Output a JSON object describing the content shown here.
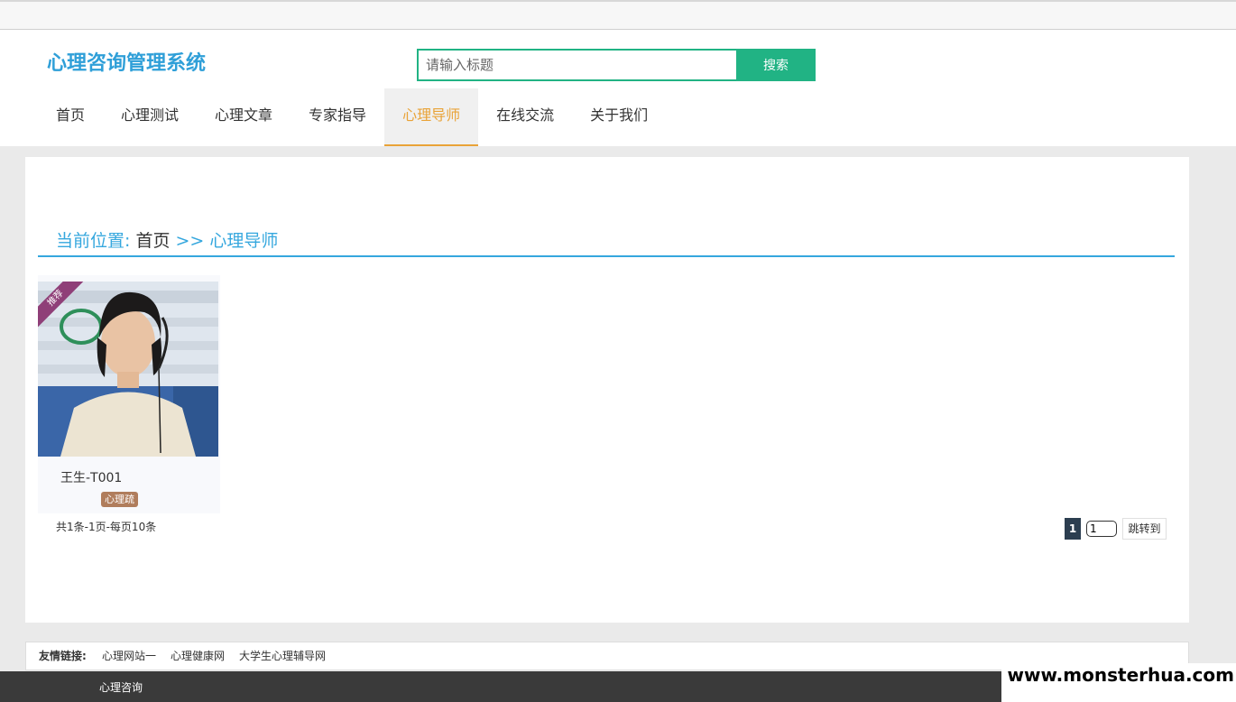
{
  "header": {
    "logo": "心理咨询管理系统",
    "search_placeholder": "请输入标题",
    "search_button": "搜索"
  },
  "nav": {
    "items": [
      "首页",
      "心理测试",
      "心理文章",
      "专家指导",
      "心理导师",
      "在线交流",
      "关于我们"
    ],
    "active": "心理导师"
  },
  "breadcrumb": {
    "label": "当前位置:",
    "home": "首页",
    "separator": ">>",
    "current": "心理导师"
  },
  "teachers": [
    {
      "ribbon": "推荐",
      "name": "王生-T001",
      "badge": "心理疏"
    }
  ],
  "pagination": {
    "summary": "共1条-1页-每页10条",
    "current_page": "1",
    "input_value": "1",
    "jump_button": "跳转到"
  },
  "links": {
    "title": "友情链接:",
    "items": [
      "心理网站一",
      "心理健康网",
      "大学生心理辅导网"
    ]
  },
  "footer": {
    "text": "心理咨询"
  },
  "watermark": "www.monsterhua.com",
  "colors": {
    "accent_green": "#21b384",
    "brand_blue": "#2f9fd8",
    "nav_active": "#e9a338"
  }
}
